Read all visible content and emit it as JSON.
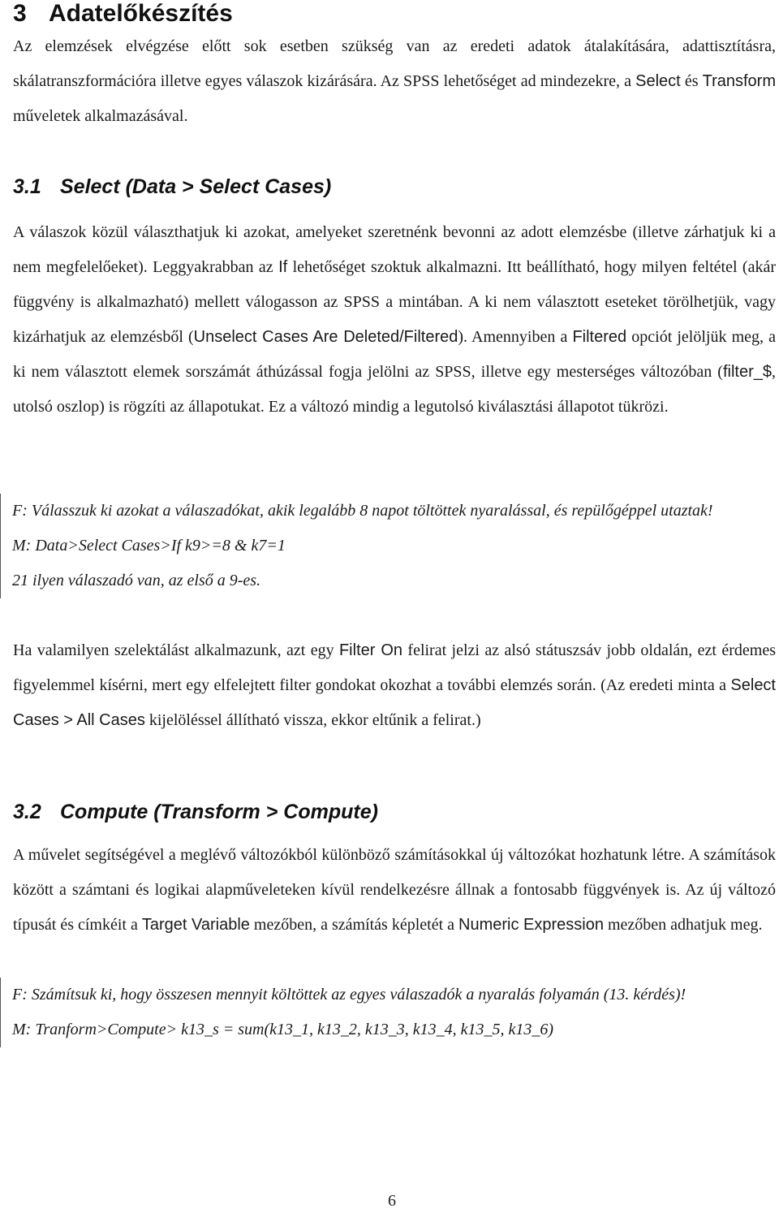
{
  "chapter": {
    "number": "3",
    "title": "Adatelőkészítés",
    "intro": {
      "t1": "Az elemzések elvégzése előtt sok esetben szükség van az eredeti adatok átalakítására, adattisztításra, skálatranszformációra illetve egyes válaszok kizárására. Az SPSS lehetőséget ad mindezekre, a ",
      "k1": "Select",
      "t2": " és ",
      "k2": "Transform",
      "t3": " műveletek alkalmazásával."
    }
  },
  "section_select": {
    "number": "3.1",
    "title": "Select (Data > Select Cases)",
    "para1": {
      "t1": "A válaszok közül választhatjuk ki azokat, amelyeket szeretnénk bevonni az adott elemzésbe (illetve zárhatjuk ki a nem megfelelőeket). Leggyakrabban az ",
      "k1": "If",
      "t2": " lehetőséget szoktuk alkalmazni. Itt beállítható, hogy milyen feltétel (akár függvény is alkalmazható) mellett válogasson az SPSS a mintában. A ki nem választott eseteket törölhetjük, vagy kizárhatjuk az elemzésből (",
      "k2": "Unselect Cases Are Deleted/Filtered",
      "t3": "). Amennyiben a ",
      "k3": "Filtered",
      "t4": " opciót jelöljük meg, a ki nem választott elemek sorszámát áthúzással fogja jelölni az SPSS, illetve egy mesterséges változóban (",
      "k4": "filter_$",
      "t5": ", utolsó oszlop) is rögzíti az állapotukat. Ez a változó mindig a legutolsó kiválasztási állapotot tükrözi."
    },
    "task": {
      "question": "F: Válasszuk ki azokat a válaszadókat, akik legalább 8 napot töltöttek nyaralással, és repülőgéppel utaztak!",
      "method": "M: Data>Select Cases>If k9>=8 & k7=1",
      "result": "21 ilyen válaszadó van, az első a 9-es."
    },
    "para2": {
      "t1": "Ha valamilyen szelektálást alkalmazunk, azt egy ",
      "k1": "Filter On",
      "t2": " felirat jelzi az alsó státuszsáv jobb oldalán, ezt érdemes figyelemmel kísérni, mert egy elfelejtett filter gondokat okozhat a további elemzés során. (Az eredeti minta a ",
      "k2": "Select Cases > All Cases",
      "t3": " kijelöléssel állítható vissza, ekkor eltűnik a felirat.)"
    }
  },
  "section_compute": {
    "number": "3.2",
    "title": "Compute (Transform > Compute)",
    "para1": {
      "t1": "A művelet segítségével a meglévő változókból különböző számításokkal új változókat hozhatunk létre. A számítások között a számtani és logikai alapműveleteken kívül rendelkezésre állnak a fontosabb függvények is. Az új változó típusát és címkéit a ",
      "k1": "Target Variable",
      "t2": " mezőben, a számítás képletét a ",
      "k2": "Numeric Expression",
      "t3": " mezőben adhatjuk meg."
    },
    "task": {
      "question": "F: Számítsuk ki, hogy összesen mennyit költöttek az egyes válaszadók a nyaralás folyamán (13. kérdés)!",
      "method": "M: Tranform>Compute> k13_s = sum(k13_1, k13_2, k13_3, k13_4, k13_5, k13_6)"
    }
  },
  "footer": {
    "page_number": "6"
  }
}
